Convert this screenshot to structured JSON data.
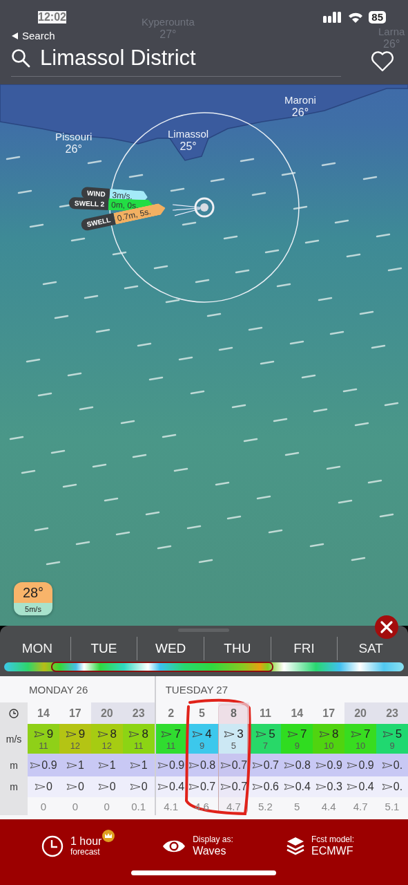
{
  "status_bar": {
    "time": "12:02",
    "back": "Search",
    "battery": "85"
  },
  "header": {
    "title": "Limassol District"
  },
  "map": {
    "places": [
      {
        "name": "Kyperounta",
        "temp": "27°"
      },
      {
        "name": "Larna",
        "temp": "26°"
      },
      {
        "name": "Pissouri",
        "temp": "26°"
      },
      {
        "name": "Limassol",
        "temp": "25°"
      },
      {
        "name": "Maroni",
        "temp": "26°"
      }
    ],
    "layers": [
      {
        "kind": "wind",
        "label": "WIND",
        "value": "3m/s."
      },
      {
        "kind": "swell2",
        "label": "SWELL 2",
        "value": "0m, 0s."
      },
      {
        "kind": "swell",
        "label": "SWELL",
        "value": "0.7m, 5s."
      }
    ],
    "badge": {
      "temp": "28°",
      "wind": "5m/s"
    }
  },
  "days": [
    {
      "label": "MON",
      "selected": false
    },
    {
      "label": "TUE",
      "selected": true
    },
    {
      "label": "WED",
      "selected": true
    },
    {
      "label": "THU",
      "selected": true
    },
    {
      "label": "FRI",
      "selected": false
    },
    {
      "label": "SAT",
      "selected": false
    }
  ],
  "table": {
    "row_labels": [
      "m/s",
      "m",
      "m"
    ],
    "days": [
      {
        "label": "MONDAY 26",
        "hours": [
          {
            "time": "14",
            "night": false,
            "selected": false,
            "wind": "9",
            "gust": "11",
            "color": "#8fd018",
            "swell": "0.9",
            "swell2": "0",
            "extra": "0"
          },
          {
            "time": "17",
            "night": false,
            "selected": false,
            "wind": "9",
            "gust": "12",
            "color": "#b4c414",
            "swell": "1",
            "swell2": "0",
            "extra": "0"
          },
          {
            "time": "20",
            "night": true,
            "selected": false,
            "wind": "8",
            "gust": "12",
            "color": "#a6cc12",
            "swell": "1",
            "swell2": "0",
            "extra": "0"
          },
          {
            "time": "23",
            "night": true,
            "selected": false,
            "wind": "8",
            "gust": "11",
            "color": "#8cd414",
            "swell": "1",
            "swell2": "0",
            "extra": "0.1"
          }
        ]
      },
      {
        "label": "TUESDAY 27",
        "hours": [
          {
            "time": "2",
            "night": false,
            "selected": false,
            "wind": "7",
            "gust": "11",
            "color": "#30dc30",
            "swell": "0.9",
            "swell2": "0.4",
            "extra": "4.1"
          },
          {
            "time": "5",
            "night": false,
            "selected": false,
            "wind": "4",
            "gust": "9",
            "color": "#3cc8ec",
            "swell": "0.8",
            "swell2": "0.7",
            "extra": "4.6"
          },
          {
            "time": "8",
            "night": false,
            "selected": true,
            "wind": "3",
            "gust": "5",
            "color": "#cdeef8",
            "swell": "0.7",
            "swell2": "0.7",
            "extra": "4.7"
          },
          {
            "time": "11",
            "night": false,
            "selected": false,
            "wind": "5",
            "gust": "7",
            "color": "#28d868",
            "swell": "0.7",
            "swell2": "0.6",
            "extra": "5.2"
          },
          {
            "time": "14",
            "night": false,
            "selected": false,
            "wind": "7",
            "gust": "9",
            "color": "#30dc20",
            "swell": "0.8",
            "swell2": "0.4",
            "extra": "5"
          },
          {
            "time": "17",
            "night": false,
            "selected": false,
            "wind": "8",
            "gust": "10",
            "color": "#50d410",
            "swell": "0.9",
            "swell2": "0.3",
            "extra": "4.4"
          },
          {
            "time": "20",
            "night": true,
            "selected": false,
            "wind": "7",
            "gust": "10",
            "color": "#38dc20",
            "swell": "0.9",
            "swell2": "0.4",
            "extra": "4.7"
          },
          {
            "time": "23",
            "night": true,
            "selected": false,
            "wind": "5",
            "gust": "9",
            "color": "#20d870",
            "swell": "0.",
            "swell2": "0.",
            "extra": "5.1"
          }
        ]
      }
    ]
  },
  "footer": [
    {
      "kind": "clock",
      "value": "1 hour",
      "caption": "forecast",
      "premium": true
    },
    {
      "kind": "eye",
      "caption": "Display as:",
      "value": "Waves"
    },
    {
      "kind": "layers",
      "caption": "Fcst model:",
      "value": "ECMWF"
    }
  ]
}
